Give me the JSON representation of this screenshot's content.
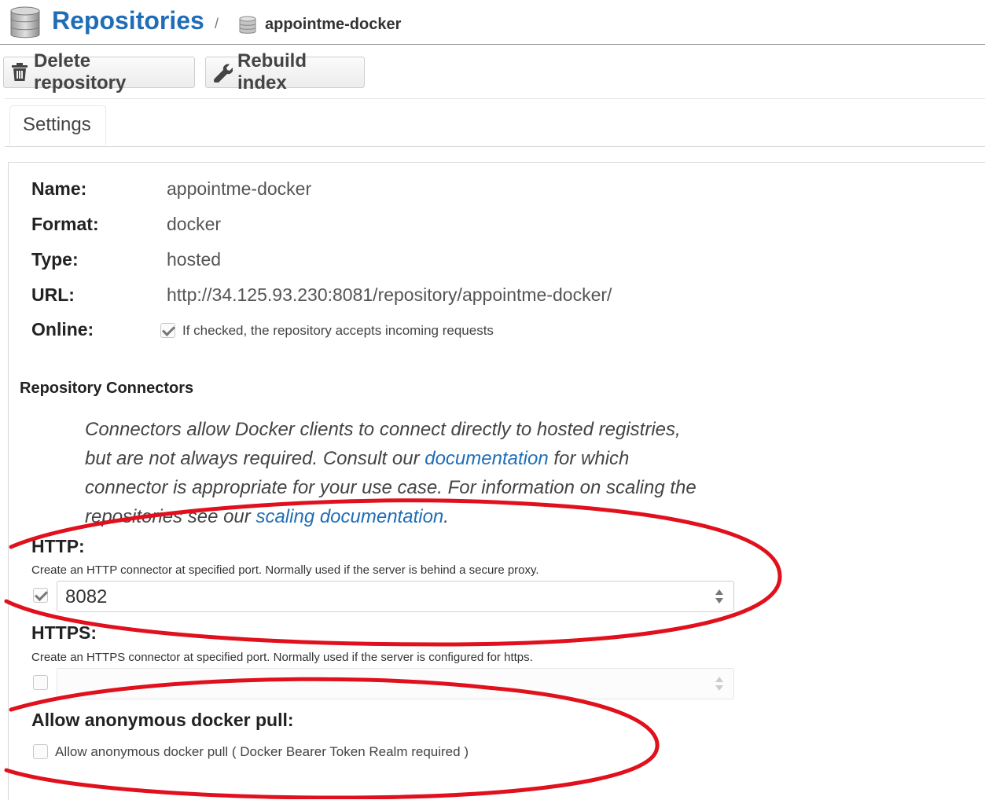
{
  "header": {
    "title": "Repositories",
    "separator": "/",
    "repository_name": "appointme-docker"
  },
  "toolbar": {
    "delete_label": "Delete repository",
    "rebuild_label": "Rebuild index"
  },
  "tabs": [
    {
      "label": "Settings"
    }
  ],
  "settings": {
    "fields": [
      {
        "label": "Name:",
        "value": "appointme-docker"
      },
      {
        "label": "Format:",
        "value": "docker"
      },
      {
        "label": "Type:",
        "value": "hosted"
      },
      {
        "label": "URL:",
        "value": "http://34.125.93.230:8081/repository/appointme-docker/"
      }
    ],
    "online": {
      "label": "Online:",
      "checked": true,
      "help": "If checked, the repository accepts incoming requests"
    }
  },
  "connectors": {
    "section_title": "Repository Connectors",
    "description": {
      "part1": "Connectors allow Docker clients to connect directly to hosted registries, but are not always required. Consult our ",
      "link1": "documentation",
      "part2": " for which connector is appropriate for your use case. For information on scaling the repositories see our ",
      "link2": "scaling documentation",
      "part3": "."
    },
    "http": {
      "title": "HTTP:",
      "help": "Create an HTTP connector at specified port. Normally used if the server is behind a secure proxy.",
      "checked": true,
      "port": "8082"
    },
    "https": {
      "title": "HTTPS:",
      "help": "Create an HTTPS connector at specified port. Normally used if the server is configured for https.",
      "checked": false,
      "port": ""
    }
  },
  "anonymous_pull": {
    "title": "Allow anonymous docker pull:",
    "checked": false,
    "label": "Allow anonymous docker pull ( Docker Bearer Token Realm required )"
  },
  "colors": {
    "accent": "#1f6db7",
    "annotation": "#e0101c"
  }
}
